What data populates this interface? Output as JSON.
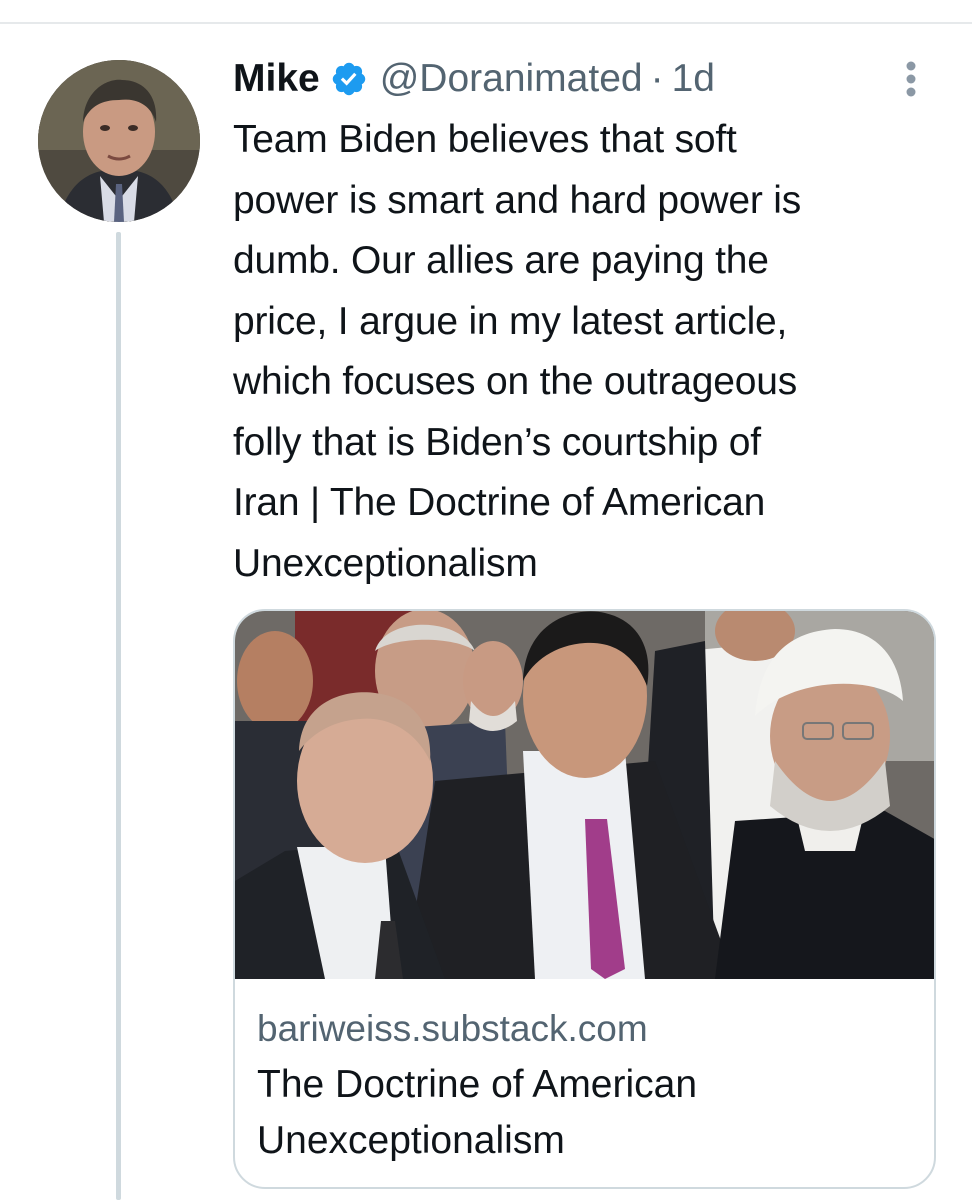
{
  "tweet": {
    "author_name": "Mike",
    "author_handle": "@Doranimated",
    "separator": "·",
    "timestamp": "1d",
    "verified": true,
    "text_lines": [
      "Team Biden believes that soft",
      "power is smart and hard power is",
      "dumb. Our allies are paying the",
      "price, I argue in my latest article,",
      "which focuses on the outrageous",
      "folly that is Biden’s courtship of",
      "Iran | The Doctrine of American",
      "Unexceptionalism"
    ]
  },
  "link_card": {
    "domain": "bariweiss.substack.com",
    "title_lines": [
      "The Doctrine of American",
      "Unexceptionalism"
    ]
  },
  "icons": {
    "verified": "verified-badge-icon",
    "more": "more-options-icon"
  },
  "colors": {
    "text": "#0f1419",
    "secondary": "#536471",
    "verified_blue": "#1d9bf0",
    "border": "#cfd9de"
  }
}
